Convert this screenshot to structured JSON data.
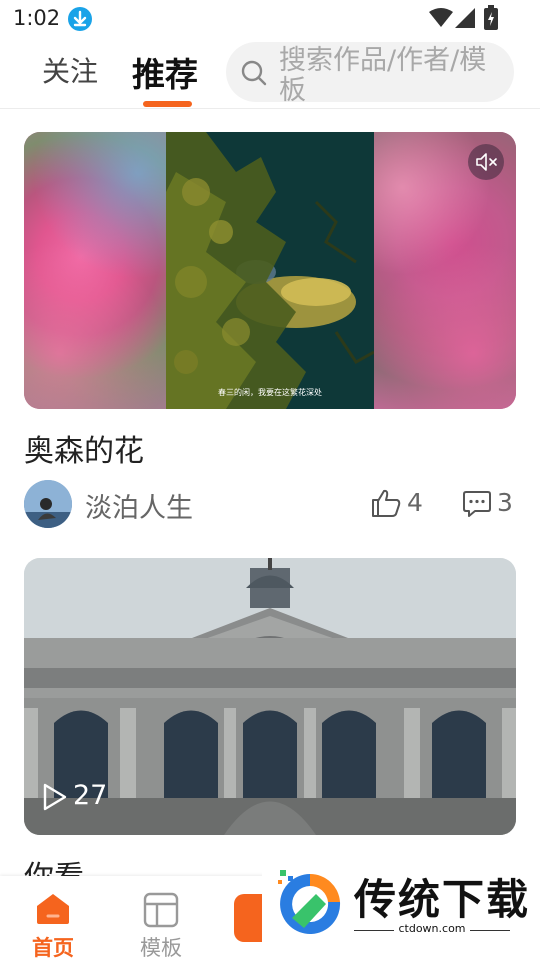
{
  "status_bar": {
    "time": "1:02",
    "icons": [
      "download-icon",
      "wifi-icon",
      "signal-icon",
      "battery-icon"
    ]
  },
  "header": {
    "tabs": [
      {
        "label": "关注",
        "active": false
      },
      {
        "label": "推荐",
        "active": true
      }
    ],
    "search": {
      "placeholder": "搜索作品/作者/模板"
    },
    "accent_color": "#f5641e"
  },
  "feed": [
    {
      "title": "奥森的花",
      "author": "淡泊人生",
      "likes": "4",
      "comments": "3",
      "caption": "春三的闲，我要在这繁花深处",
      "muted": true
    },
    {
      "title": "你看",
      "plays": "27"
    }
  ],
  "bottom_nav": {
    "items": [
      {
        "label": "首页",
        "icon": "home-icon",
        "active": true
      },
      {
        "label": "模板",
        "icon": "template-icon",
        "active": false
      }
    ]
  },
  "watermark": {
    "title": "传统下载",
    "url": "ctdown.com"
  }
}
